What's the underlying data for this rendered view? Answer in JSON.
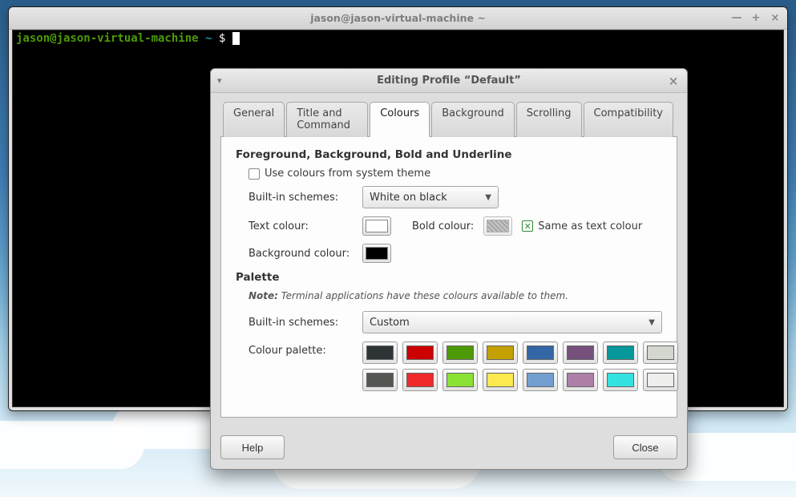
{
  "terminal": {
    "title": "jason@jason-virtual-machine ~",
    "prompt_user_host": "jason@jason-virtual-machine",
    "prompt_path": "~",
    "prompt_symbol": "$"
  },
  "dialog": {
    "title": "Editing Profile “Default”",
    "tabs": [
      "General",
      "Title and Command",
      "Colours",
      "Background",
      "Scrolling",
      "Compatibility"
    ],
    "active_tab": "Colours",
    "help_label": "Help",
    "close_label": "Close"
  },
  "colours": {
    "section1_title": "Foreground, Background, Bold and Underline",
    "use_system_label": "Use colours from system theme",
    "use_system_checked": false,
    "builtin_label": "Built-in schemes:",
    "builtin_value": "White on black",
    "text_colour_label": "Text colour:",
    "text_colour": "#ffffff",
    "bold_colour_label": "Bold colour:",
    "bold_colour": "#808080",
    "same_as_text_label": "Same as text colour",
    "same_as_text_checked": true,
    "bg_colour_label": "Background colour:",
    "bg_colour": "#000000",
    "palette_title": "Palette",
    "palette_note_prefix": "Note:",
    "palette_note": "Terminal applications have these colours available to them.",
    "palette_builtin_label": "Built-in schemes:",
    "palette_builtin_value": "Custom",
    "palette_label": "Colour palette:",
    "palette_colors_row1": [
      "#2e3436",
      "#cc0000",
      "#4e9a06",
      "#c4a000",
      "#3465a4",
      "#75507b",
      "#06989a",
      "#d3d7cf"
    ],
    "palette_colors_row2": [
      "#555753",
      "#ef2929",
      "#8ae234",
      "#fce94f",
      "#729fcf",
      "#ad7fa8",
      "#34e2e2",
      "#eeeeec"
    ]
  }
}
